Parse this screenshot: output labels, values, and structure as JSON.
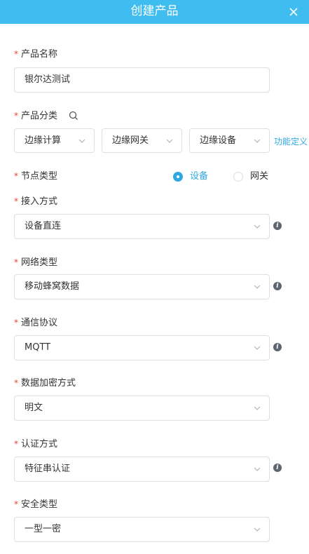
{
  "header": {
    "title": "创建产品"
  },
  "product_name": {
    "label": "产品名称",
    "value": "银尔达测试"
  },
  "product_category": {
    "label": "产品分类",
    "selects": [
      "边缘计算",
      "边缘网关",
      "边缘设备"
    ],
    "link": "功能定义"
  },
  "node_type": {
    "label": "节点类型",
    "options": [
      "设备",
      "网关"
    ],
    "selected": "设备"
  },
  "access_method": {
    "label": "接入方式",
    "value": "设备直连"
  },
  "network_type": {
    "label": "网络类型",
    "value": "移动蜂窝数据"
  },
  "protocol": {
    "label": "通信协议",
    "value": "MQTT"
  },
  "encryption": {
    "label": "数据加密方式",
    "value": "明文"
  },
  "auth_method": {
    "label": "认证方式",
    "value": "特征串认证"
  },
  "security_type": {
    "label": "安全类型",
    "value": "一型一密"
  },
  "colors": {
    "header": "#3fbcf0",
    "accent": "#2fa8e0",
    "required": "#e0492f"
  }
}
